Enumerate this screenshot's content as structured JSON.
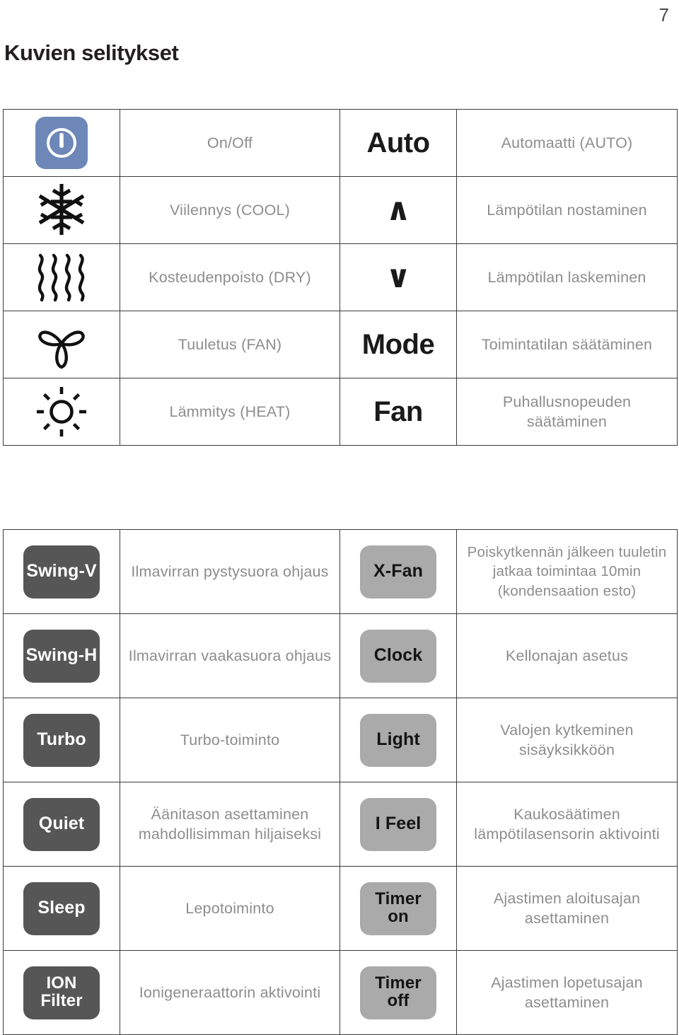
{
  "page": {
    "number": "7",
    "title": "Kuvien selitykset"
  },
  "modes_table": {
    "rows": [
      {
        "icon": "power-on-off-icon",
        "icon_label": "",
        "desc_left": "On/Off",
        "key": "Auto",
        "key_kind": "text",
        "desc_right": "Automaatti (AUTO)"
      },
      {
        "icon": "snowflake-icon",
        "icon_label": "",
        "desc_left": "Viilennys (COOL)",
        "key": "∧",
        "key_kind": "arrow",
        "desc_right": "Lämpötilan nostaminen"
      },
      {
        "icon": "humidity-waves-icon",
        "icon_label": "",
        "desc_left": "Kosteudenpoisto (DRY)",
        "key": "∨",
        "key_kind": "arrow",
        "desc_right": "Lämpötilan laskeminen"
      },
      {
        "icon": "fan-blades-icon",
        "icon_label": "",
        "desc_left": "Tuuletus (FAN)",
        "key": "Mode",
        "key_kind": "text",
        "desc_right": "Toimintatilan säätäminen"
      },
      {
        "icon": "sun-icon",
        "icon_label": "",
        "desc_left": "Lämmitys (HEAT)",
        "key": "Fan",
        "key_kind": "text",
        "desc_right": "Puhallusnopeuden säätäminen"
      }
    ]
  },
  "functions_table": {
    "rows": [
      {
        "pill_left": "Swing-V",
        "pill_left_lines": [
          "Swing-V"
        ],
        "desc_left": "Ilmavirran pystysuora ohjaus",
        "pill_right": "X-Fan",
        "pill_right_lines": [
          "X-Fan"
        ],
        "desc_right": "Poiskytkennän jälkeen tuuletin jatkaa toimintaa 10min (kondensaation esto)"
      },
      {
        "pill_left": "Swing-H",
        "pill_left_lines": [
          "Swing-H"
        ],
        "desc_left": "Ilmavirran vaakasuora ohjaus",
        "pill_right": "Clock",
        "pill_right_lines": [
          "Clock"
        ],
        "desc_right": "Kellonajan asetus"
      },
      {
        "pill_left": "Turbo",
        "pill_left_lines": [
          "Turbo"
        ],
        "desc_left": "Turbo-toiminto",
        "pill_right": "Light",
        "pill_right_lines": [
          "Light"
        ],
        "desc_right": "Valojen kytkeminen sisäyksikköön"
      },
      {
        "pill_left": "Quiet",
        "pill_left_lines": [
          "Quiet"
        ],
        "desc_left": "Äänitason asettaminen mahdollisimman hiljaiseksi",
        "pill_right": "I Feel",
        "pill_right_lines": [
          "I Feel"
        ],
        "desc_right": "Kaukosäätimen lämpötilasensorin aktivointi"
      },
      {
        "pill_left": "Sleep",
        "pill_left_lines": [
          "Sleep"
        ],
        "desc_left": "Lepotoiminto",
        "pill_right": "Timer on",
        "pill_right_lines": [
          "Timer",
          "on"
        ],
        "desc_right": "Ajastimen aloitusajan asettaminen"
      },
      {
        "pill_left": "ION Filter",
        "pill_left_lines": [
          "ION",
          "Filter"
        ],
        "desc_left": "Ionigeneraattorin aktivointi",
        "pill_right": "Timer off",
        "pill_right_lines": [
          "Timer",
          "off"
        ],
        "desc_right": "Ajastimen lopetusajan asettaminen"
      }
    ]
  },
  "colors": {
    "power_button": "#6d87b8",
    "pill_dark": "#565656",
    "pill_light": "#aaaaaa",
    "border": "#3b3b3b",
    "description_text": "#8d8d8d",
    "key_text": "#1a1a1a"
  }
}
